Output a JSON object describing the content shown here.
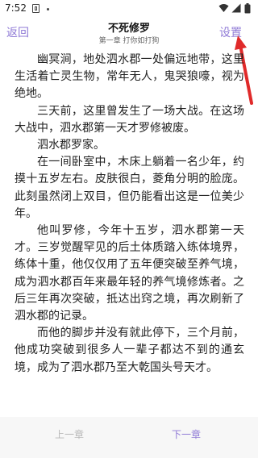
{
  "status_bar": {
    "time": "7:52",
    "icons": [
      "sim-icon",
      "notification-dot-icon",
      "wifi-icon",
      "signal-icon",
      "battery-icon"
    ]
  },
  "nav": {
    "back_label": "返回",
    "title": "不死修罗",
    "subtitle": "第一章 打你如打狗",
    "settings_label": "设置"
  },
  "content": {
    "paragraphs": [
      "幽冥涧，地处泗水郡一处偏远地带，这里生活着亡灵生物，常年无人，鬼哭狼嚎，视为绝地。",
      "三天前，这里曾发生了一场大战。在这场大战中，泗水郡第一天才罗修被废。",
      "泗水郡罗家。",
      "在一间卧室中，木床上躺着一名少年，约摸十五岁左右。皮肤很白，菱角分明的脸庞。此刻虽然闭上双目，但仍能看出这是一位美少年。",
      "他叫罗修，今年十五岁，泗水郡第一天才。三岁觉醒罕见的后土体质踏入练体境界，练体十重，他仅仅用了五年便突破至养气境，成为泗水郡百年来最年轻的养气境修炼者。之后三年再次突破，抵达出窍之境，再次刷新了泗水郡的记录。",
      "而他的脚步并没有就此停下，三个月前，他成功突破到很多人一辈子都达不到的通玄境，成为了泗水郡乃至大乾国头号天才。"
    ]
  },
  "bottom_bar": {
    "prev_label": "上一章",
    "next_label": "下一章"
  },
  "colors": {
    "accent": "#8f7ad6",
    "disabled": "#b7b7b7",
    "annotation": "#e02a2a",
    "bottom_bg": "#f7f7f7"
  }
}
